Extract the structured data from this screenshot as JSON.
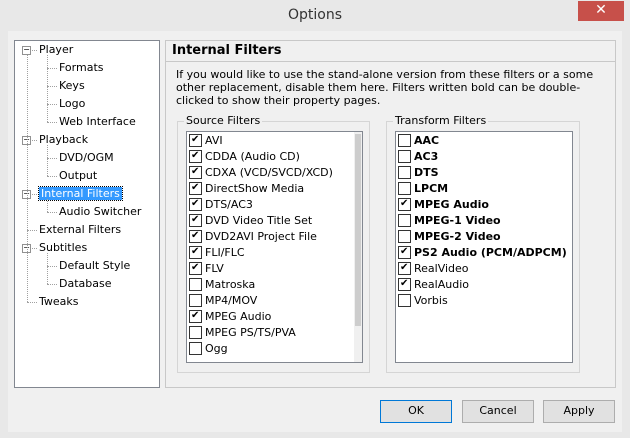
{
  "window": {
    "title": "Options",
    "close_glyph": "✕"
  },
  "tree": [
    {
      "label": "Player",
      "level": 0,
      "expander": "⊟"
    },
    {
      "label": "Formats",
      "level": 1
    },
    {
      "label": "Keys",
      "level": 1
    },
    {
      "label": "Logo",
      "level": 1
    },
    {
      "label": "Web Interface",
      "level": 1
    },
    {
      "label": "Playback",
      "level": 0,
      "expander": "⊟"
    },
    {
      "label": "DVD/OGM",
      "level": 1
    },
    {
      "label": "Output",
      "level": 1
    },
    {
      "label": "Internal Filters",
      "level": 0,
      "expander": "⊟",
      "selected": true
    },
    {
      "label": "Audio Switcher",
      "level": 1
    },
    {
      "label": "External Filters",
      "level": 0
    },
    {
      "label": "Subtitles",
      "level": 0,
      "expander": "⊟"
    },
    {
      "label": "Default Style",
      "level": 1
    },
    {
      "label": "Database",
      "level": 1
    },
    {
      "label": "Tweaks",
      "level": 0
    }
  ],
  "panel": {
    "title": "Internal Filters",
    "description": "If you would like to use the stand-alone version from these filters or a some other replacement, disable them here. Filters written bold can be double-clicked to show their property pages."
  },
  "source_filters": {
    "legend": "Source Filters",
    "items": [
      {
        "label": "AVI",
        "checked": true
      },
      {
        "label": "CDDA (Audio CD)",
        "checked": true
      },
      {
        "label": "CDXA (VCD/SVCD/XCD)",
        "checked": true
      },
      {
        "label": "DirectShow Media",
        "checked": true
      },
      {
        "label": "DTS/AC3",
        "checked": true
      },
      {
        "label": "DVD Video Title Set",
        "checked": true
      },
      {
        "label": "DVD2AVI Project File",
        "checked": true
      },
      {
        "label": "FLI/FLC",
        "checked": true
      },
      {
        "label": "FLV",
        "checked": true
      },
      {
        "label": "Matroska",
        "checked": false
      },
      {
        "label": "MP4/MOV",
        "checked": false
      },
      {
        "label": "MPEG Audio",
        "checked": true
      },
      {
        "label": "MPEG PS/TS/PVA",
        "checked": false
      },
      {
        "label": "Ogg",
        "checked": false
      }
    ],
    "scroll_thumb_fraction": 0.85
  },
  "transform_filters": {
    "legend": "Transform Filters",
    "items": [
      {
        "label": "AAC",
        "checked": false,
        "bold": true
      },
      {
        "label": "AC3",
        "checked": false,
        "bold": true
      },
      {
        "label": "DTS",
        "checked": false,
        "bold": true
      },
      {
        "label": "LPCM",
        "checked": false,
        "bold": true
      },
      {
        "label": "MPEG Audio",
        "checked": true,
        "bold": true
      },
      {
        "label": "MPEG-1 Video",
        "checked": false,
        "bold": true
      },
      {
        "label": "MPEG-2 Video",
        "checked": false,
        "bold": true
      },
      {
        "label": "PS2 Audio (PCM/ADPCM)",
        "checked": true,
        "bold": true
      },
      {
        "label": "RealVideo",
        "checked": true,
        "bold": false
      },
      {
        "label": "RealAudio",
        "checked": true,
        "bold": false
      },
      {
        "label": "Vorbis",
        "checked": false,
        "bold": false
      }
    ]
  },
  "buttons": {
    "ok": "OK",
    "cancel": "Cancel",
    "apply": "Apply"
  }
}
